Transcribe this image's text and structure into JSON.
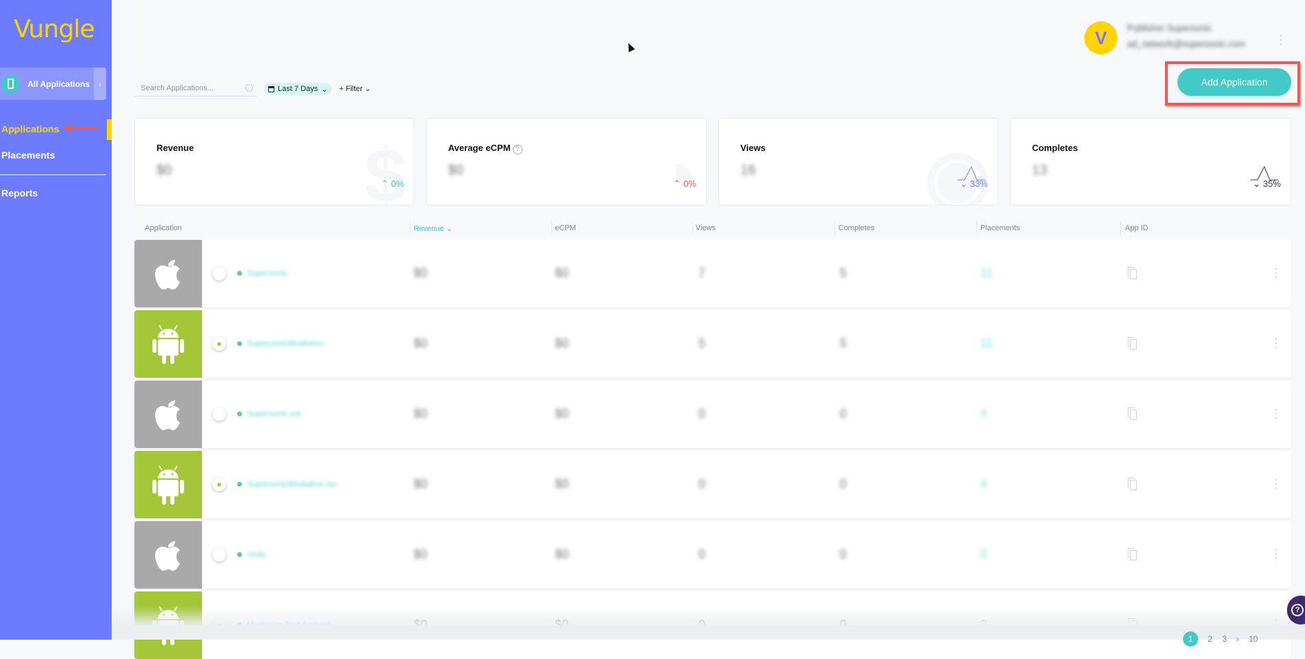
{
  "brand": {
    "logo": "Vungle",
    "accent": "#6d7cff",
    "logo_color": "#ffd400",
    "teal": "#42cbc6"
  },
  "sidebar": {
    "selector": {
      "label": "All Applications",
      "icon": "phone-icon"
    },
    "items": [
      {
        "label": "Applications",
        "active": true
      },
      {
        "label": "Placements"
      },
      {
        "label": "Reports"
      }
    ]
  },
  "header": {
    "avatar_glyph": "V",
    "user_name": "Publisher Supersonic",
    "user_email": "ad_network@supersonic.com"
  },
  "toolbar": {
    "search_placeholder": "Search Applications...",
    "date_range": "Last 7 Days",
    "filter_label": "+ Filter",
    "add_label": "Add Application"
  },
  "cards": [
    {
      "title": "Revenue",
      "value": "$0",
      "change": "0%",
      "direction": "up",
      "color": "#3fcbc4"
    },
    {
      "title": "Average eCPM",
      "value": "$0",
      "change": "0%",
      "direction": "up",
      "color": "#f25a4f",
      "help": "?"
    },
    {
      "title": "Views",
      "value": "16",
      "change": "33%",
      "direction": "down",
      "color": "#6d7cff"
    },
    {
      "title": "Completes",
      "value": "13",
      "change": "35%",
      "direction": "down",
      "color": "#3d2a6e"
    }
  ],
  "table": {
    "columns": [
      "Application",
      "Revenue",
      "eCPM",
      "Views",
      "Completes",
      "Placements",
      "App ID"
    ],
    "sort_indicator": "⌄",
    "rows": [
      {
        "platform": "ios",
        "name": "Supersonic",
        "revenue": "$0",
        "ecpm": "$0",
        "views": "7",
        "completes": "5",
        "placements": "11"
      },
      {
        "platform": "android",
        "name": "SupersonicMediation",
        "revenue": "$0",
        "ecpm": "$0",
        "views": "5",
        "completes": "5",
        "placements": "11"
      },
      {
        "platform": "ios",
        "name": "Supersonic.ios",
        "revenue": "$0",
        "ecpm": "$0",
        "views": "0",
        "completes": "0",
        "placements": "4"
      },
      {
        "platform": "android",
        "name": "SupersonicMediation.ios",
        "revenue": "$0",
        "ecpm": "$0",
        "views": "0",
        "completes": "0",
        "placements": "4"
      },
      {
        "platform": "ios",
        "name": "Unity",
        "revenue": "$0",
        "ecpm": "$0",
        "views": "0",
        "completes": "0",
        "placements": "0"
      },
      {
        "platform": "android",
        "name": "Mediation Test Android",
        "revenue": "$0",
        "ecpm": "$0",
        "views": "0",
        "completes": "0",
        "placements": "2"
      }
    ]
  },
  "pagination": {
    "pages": [
      "1",
      "2",
      "3"
    ],
    "next": "›",
    "last": "10",
    "current": "1"
  },
  "help_button": "?"
}
